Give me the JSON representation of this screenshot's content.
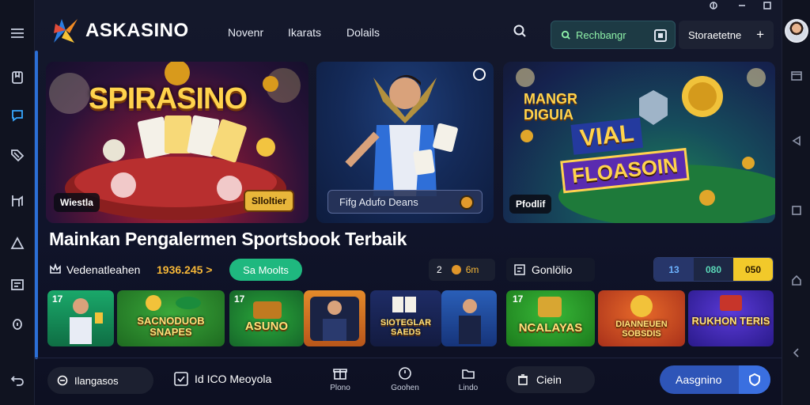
{
  "brand": {
    "name": "ASKASINO"
  },
  "nav": {
    "items": [
      "Novenr",
      "Ikarats",
      "Dolails"
    ]
  },
  "header": {
    "refresh_label": "Rechbangr",
    "status_label": "Storaetetne",
    "plus_glyph": "+"
  },
  "banners": [
    {
      "title": "SPIRASINO",
      "tag": "Wiestla"
    },
    {
      "search_placeholder": "Fifg Adufo Deans"
    },
    {
      "subtitle": "MANGR DIGUIA",
      "title_line1": "VIAL",
      "title_line2": "FLOASOIN",
      "tag": "Pfodlif"
    }
  ],
  "banner_tags": {
    "slot": "Slloltier"
  },
  "main": {
    "heading": "Mainkan Pengalermen Sportsbook Terbaik",
    "stat_label": "Vedenatleahen",
    "stat_value": "1936.245",
    "stat_arrow": ">",
    "green_button": "Sa Moolts",
    "mini_left": "2",
    "mini_right": "6m",
    "console_label": "Gonlölio",
    "segments": [
      "13",
      "080",
      "050"
    ]
  },
  "tiles": [
    {
      "label": "",
      "badge": "17"
    },
    {
      "label": "SACNODUOB SNAPES"
    },
    {
      "label": "ASUNO",
      "badge": "17"
    },
    {
      "label": ""
    },
    {
      "label": "SIOTEGLAR SAEDS"
    },
    {
      "label": ""
    },
    {
      "label": "NCALAYAS",
      "badge": "17"
    },
    {
      "label": "DIANNEUEN SOBSDIS"
    },
    {
      "label": "RUKHON TERIS"
    }
  ],
  "bottom": {
    "left_label": "Ilangasos",
    "mid_label": "Id ICO Meoyola",
    "nav": [
      {
        "label": "Plono"
      },
      {
        "label": "Goohen"
      },
      {
        "label": "Lindo"
      }
    ],
    "clear_label": "Ciein",
    "assign_label": "Aasgnino"
  },
  "colors": {
    "accent_blue": "#2e55b8",
    "accent_green": "#1fb87f",
    "accent_gold": "#f5b637",
    "background": "#10142a"
  }
}
